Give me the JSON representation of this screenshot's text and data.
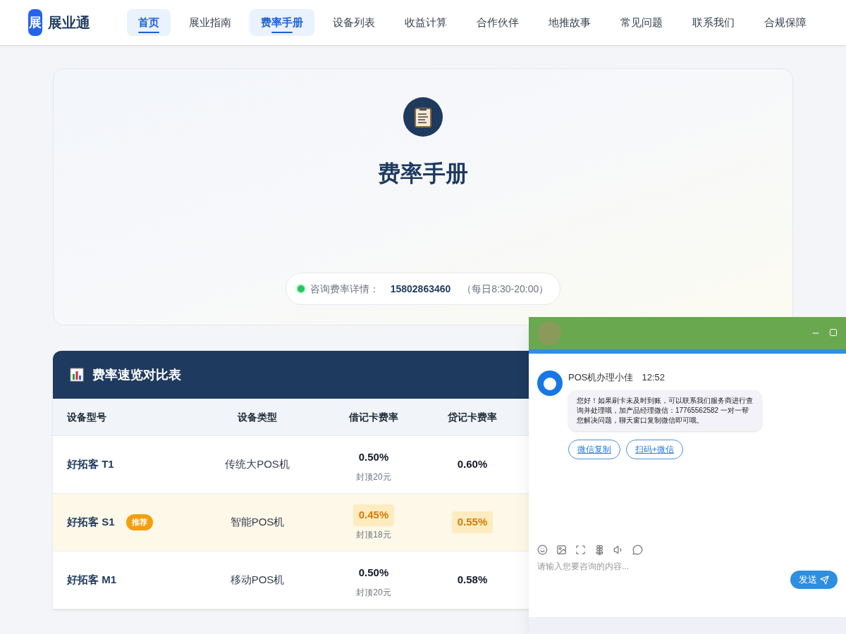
{
  "nav": {
    "logo_mark": "展",
    "brand": "展业通",
    "items": [
      {
        "label": "首页",
        "selected": true
      },
      {
        "label": "展业指南",
        "selected": false
      },
      {
        "label": "费率手册",
        "selected": true
      },
      {
        "label": "设备列表",
        "selected": false
      },
      {
        "label": "收益计算",
        "selected": false
      },
      {
        "label": "合作伙伴",
        "selected": false
      },
      {
        "label": "地推故事",
        "selected": false
      },
      {
        "label": "常见问题",
        "selected": false
      },
      {
        "label": "联系我们",
        "selected": false
      },
      {
        "label": "合规保障",
        "selected": false
      }
    ]
  },
  "hero": {
    "title": "费率手册",
    "contact": {
      "label": "咨询费率详情：",
      "phone": "15802863460",
      "hours": "（每日8:30-20:00）"
    }
  },
  "table": {
    "title": "费率速览对比表",
    "columns": [
      "设备型号",
      "设备类型",
      "借记卡费率",
      "贷记卡费率"
    ],
    "rows": [
      {
        "model": "好拓客 T1",
        "type": "传统大POS机",
        "debit": "0.50%",
        "debit_note": "封顶20元",
        "credit": "0.60%",
        "highlighted": false
      },
      {
        "model": "好拓客 S1",
        "badge": "推荐",
        "type": "智能POS机",
        "debit": "0.45%",
        "debit_note": "封顶18元",
        "credit": "0.55%",
        "highlighted": true
      },
      {
        "model": "好拓客 M1",
        "type": "移动POS机",
        "debit": "0.50%",
        "debit_note": "封顶20元",
        "credit": "0.58%",
        "highlighted": false
      }
    ]
  },
  "chat": {
    "sender": "POS机办理小佳",
    "time": "12:52",
    "message": "您好！如果刷卡未及时到账，可以联系我们服务商进行查询并处理哦，加产品经理微信：17765562582 一对一帮您解决问题，聊天窗口复制微信即可哦。",
    "actions": [
      "微信复制",
      "扫码+微信"
    ],
    "input": {
      "placeholder": "请输入您要咨询的内容..."
    },
    "send": "发送"
  }
}
